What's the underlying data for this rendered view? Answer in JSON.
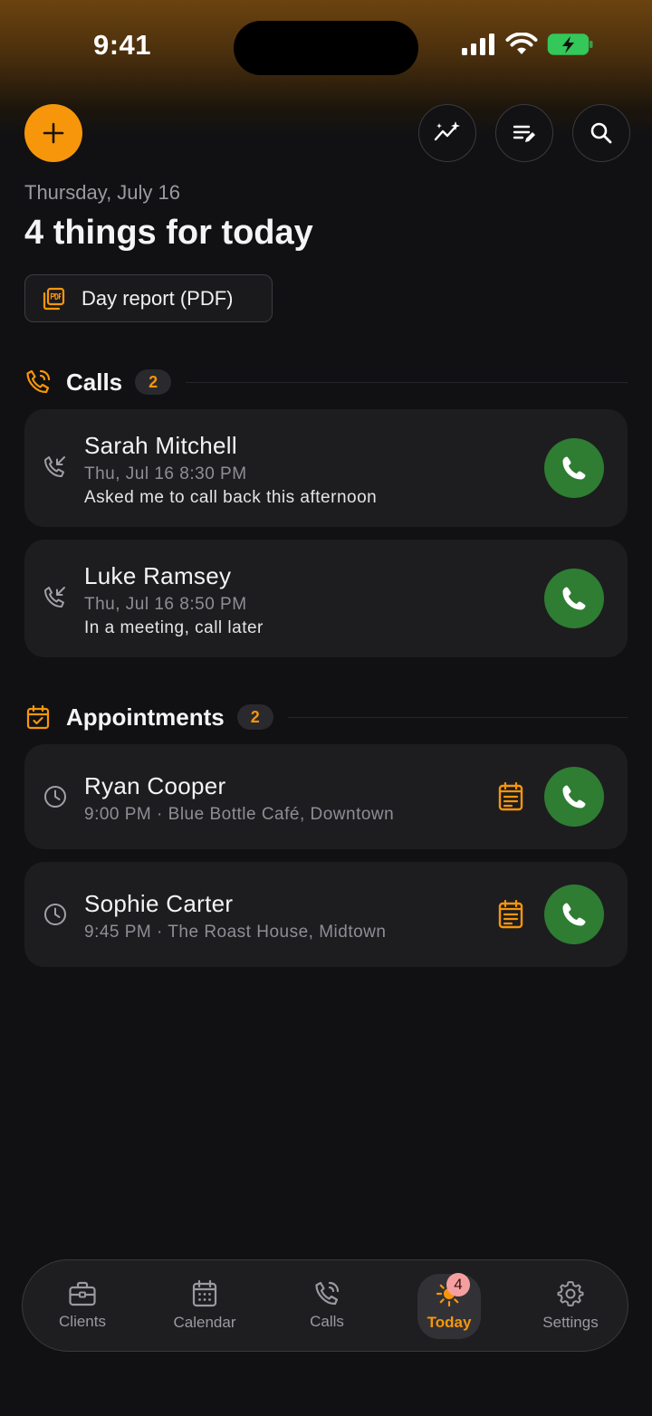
{
  "status_bar": {
    "time": "9:41"
  },
  "header": {
    "date": "Thursday, July 16",
    "title": "4 things for today",
    "report_button": "Day report (PDF)"
  },
  "calls_section": {
    "title": "Calls",
    "count": "2",
    "items": [
      {
        "name": "Sarah Mitchell",
        "time": "Thu, Jul 16 8:30 PM",
        "note": "Asked me to call back this afternoon"
      },
      {
        "name": "Luke Ramsey",
        "time": "Thu, Jul 16 8:50 PM",
        "note": "In a meeting, call later"
      }
    ]
  },
  "appointments_section": {
    "title": "Appointments",
    "count": "2",
    "items": [
      {
        "name": "Ryan Cooper",
        "detail": "9:00 PM · Blue Bottle Café, Downtown"
      },
      {
        "name": "Sophie Carter",
        "detail": "9:45 PM · The Roast House, Midtown"
      }
    ]
  },
  "tabbar": {
    "tabs": [
      {
        "label": "Clients",
        "icon": "briefcase-icon"
      },
      {
        "label": "Calendar",
        "icon": "calendar-icon"
      },
      {
        "label": "Calls",
        "icon": "phone-call-icon"
      },
      {
        "label": "Today",
        "icon": "sun-icon",
        "badge": "4"
      },
      {
        "label": "Settings",
        "icon": "gear-icon"
      }
    ],
    "active": "Today"
  },
  "colors": {
    "accent": "#f7960b",
    "call_green": "#2e7d32",
    "background": "#111113",
    "card": "#1d1d20"
  }
}
